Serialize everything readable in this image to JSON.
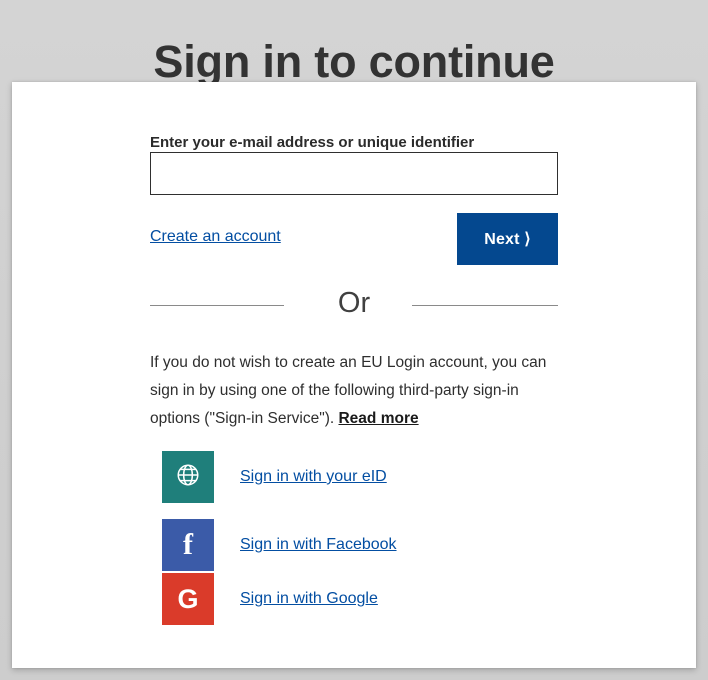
{
  "page": {
    "title": "Sign in to continue",
    "background_color": "#d2d2d2"
  },
  "form": {
    "email_label": "Enter your e-mail address or unique identifier",
    "email_value": "",
    "email_placeholder": "",
    "create_account_label": "Create an account",
    "next_button_label": "Next ⟩",
    "next_button_color": "#04488f"
  },
  "divider": {
    "label": "Or"
  },
  "third_party": {
    "intro_text": "If you do not wish to create an EU Login account, you can sign in by using one of the following third-party sign-in options (\"Sign-in Service\").",
    "read_more_label": "Read more",
    "options": [
      {
        "id": "eid",
        "label": "Sign in with your eID",
        "icon": "globe-icon",
        "color": "#1f7f7b"
      },
      {
        "id": "facebook",
        "label": "Sign in with Facebook",
        "icon": "facebook-icon",
        "glyph": "f",
        "color": "#3b5ba8"
      },
      {
        "id": "google",
        "label": "Sign in with Google",
        "icon": "google-icon",
        "glyph": "G",
        "color": "#da3b2a"
      }
    ]
  },
  "colors": {
    "link": "#034ea2",
    "title_text": "#333333",
    "body_text": "#2e2e2e"
  }
}
